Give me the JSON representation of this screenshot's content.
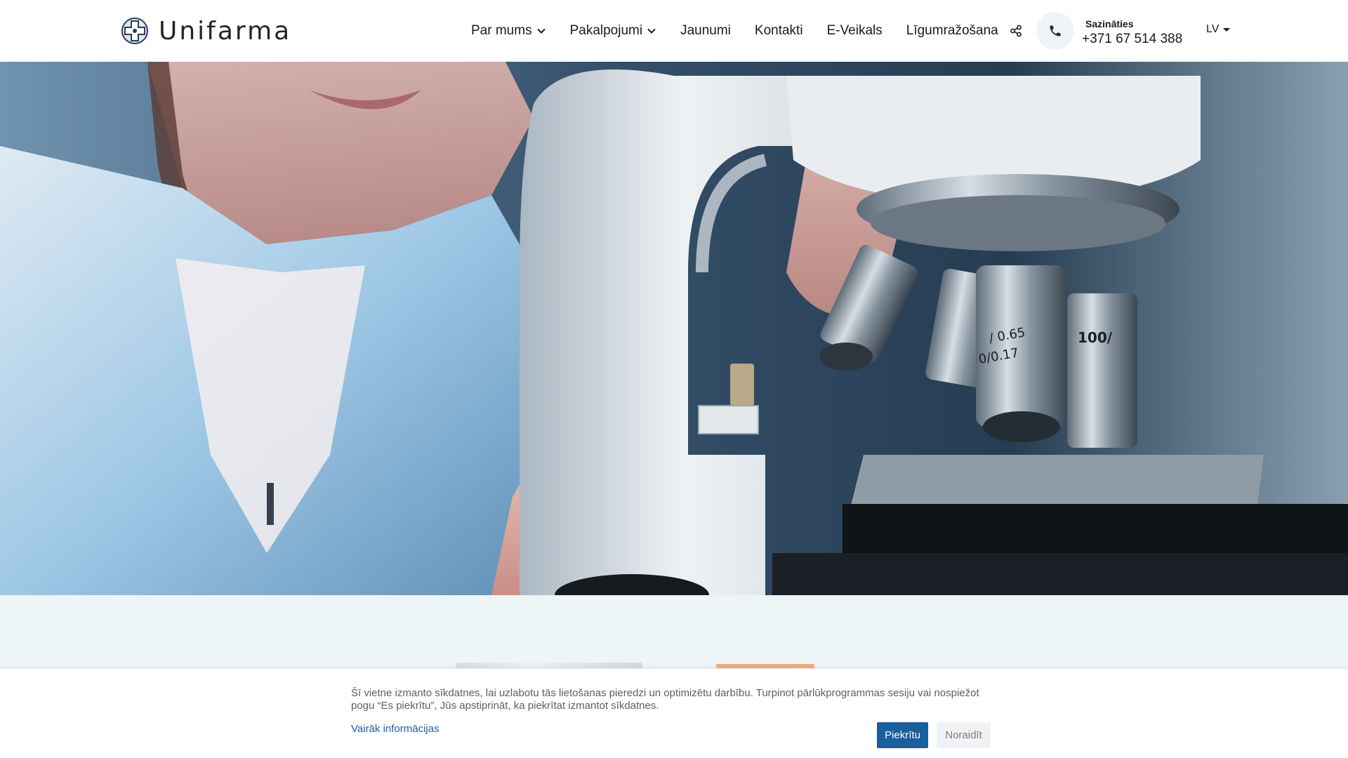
{
  "header": {
    "logo_text": "Unifarma",
    "nav": [
      {
        "label": "Par mums",
        "has_dropdown": true
      },
      {
        "label": "Pakalpojumi",
        "has_dropdown": true
      },
      {
        "label": "Jaunumi",
        "has_dropdown": false
      },
      {
        "label": "Kontakti",
        "has_dropdown": false
      },
      {
        "label": "E-Veikals",
        "has_dropdown": false
      },
      {
        "label": "Līgumražošana",
        "has_dropdown": false
      }
    ],
    "contact": {
      "label": "Sazināties",
      "phone": "+371 67 514 388"
    },
    "language": "LV",
    "icons": {
      "logo": "cross-circle-logo-icon",
      "share": "share-icon",
      "phone": "phone-icon",
      "dropdown": "chevron-down-icon"
    }
  },
  "hero": {
    "image": "laboratory-microscope-photo",
    "objective_labels": [
      "/ 0.65",
      "0/0.17",
      "100/"
    ]
  },
  "cookie_banner": {
    "text": "Šī vietne izmanto sīkdatnes, lai uzlabotu tās lietošanas pieredzi un optimizētu darbību. Turpinot pārlūkprogrammas sesiju vai nospiežot pogu “Es piekrītu”, Jūs apstiprināt, ka piekrītat izmantot sīkdatnes.",
    "more_info_link": "Vairāk informācijas",
    "accept_label": "Piekrītu",
    "decline_label": "Noraidīt"
  },
  "colors": {
    "primary": "#1a5e9e",
    "section_bg": "#eef5f6",
    "accent_orange": "#ef9a4a",
    "text_dark": "#1a1a1a"
  }
}
